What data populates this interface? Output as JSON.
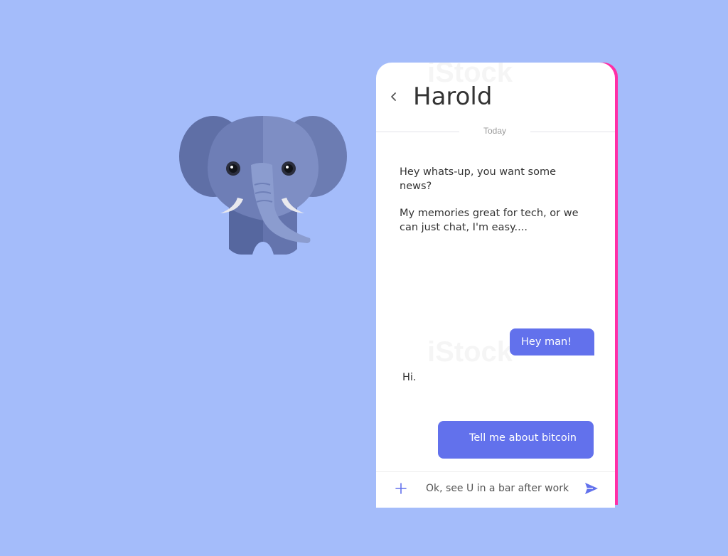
{
  "chat": {
    "contact_name": "Harold",
    "date_divider": "Today",
    "messages": [
      {
        "direction": "in",
        "paragraphs": [
          "Hey whats-up, you want some news?",
          "My memories great for tech, or we can just chat, I'm easy...."
        ]
      },
      {
        "direction": "out",
        "text": "Hey man!"
      },
      {
        "direction": "in",
        "text": "Hi."
      },
      {
        "direction": "out",
        "text": "Tell me about bitcoin"
      }
    ]
  },
  "composer": {
    "input_value": "Ok, see U in a bar after work"
  },
  "colors": {
    "background": "#a4bcfa",
    "bubble_out": "#6271ec",
    "accent": "#6271ec"
  },
  "icons": {
    "back": "chevron-left-icon",
    "attach": "plus-icon",
    "send": "send-icon",
    "mascot": "elephant-illustration"
  }
}
